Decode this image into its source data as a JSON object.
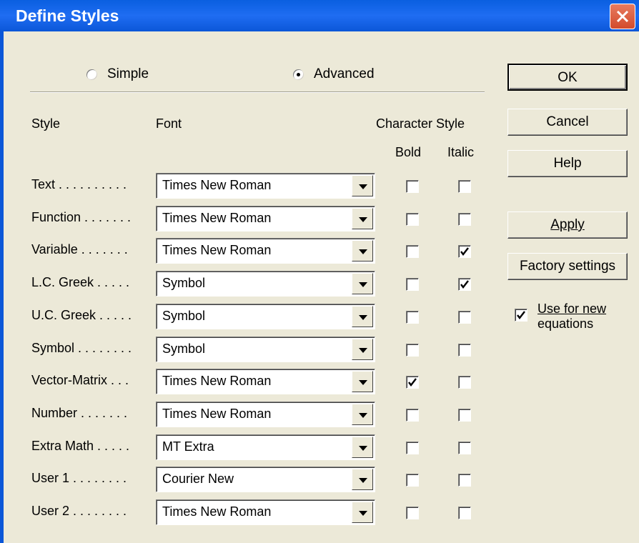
{
  "window": {
    "title": "Define Styles"
  },
  "mode": {
    "simple_label": "Simple",
    "advanced_label": "Advanced",
    "selected": "advanced"
  },
  "headers": {
    "style": "Style",
    "font": "Font",
    "character_style": "Character Style",
    "bold": "Bold",
    "italic": "Italic"
  },
  "rows": [
    {
      "label": "Text . . . . . . . . . .",
      "font": "Times New Roman",
      "bold": false,
      "italic": false
    },
    {
      "label": "Function . . . . . . .",
      "font": "Times New Roman",
      "bold": false,
      "italic": false
    },
    {
      "label": "Variable . . . . . . .",
      "font": "Times New Roman",
      "bold": false,
      "italic": true
    },
    {
      "label": "L.C. Greek . . . . .",
      "font": "Symbol",
      "bold": false,
      "italic": true
    },
    {
      "label": "U.C. Greek . . . . .",
      "font": "Symbol",
      "bold": false,
      "italic": false
    },
    {
      "label": "Symbol . . . . . . . .",
      "font": "Symbol",
      "bold": false,
      "italic": false
    },
    {
      "label": "Vector-Matrix . . .",
      "font": "Times New Roman",
      "bold": true,
      "italic": false
    },
    {
      "label": "Number . . . . . . .",
      "font": "Times New Roman",
      "bold": false,
      "italic": false
    },
    {
      "label": "Extra Math . . . . .",
      "font": "MT Extra",
      "bold": false,
      "italic": false
    },
    {
      "label": "User 1 . . . . . . . .",
      "font": "Courier New",
      "bold": false,
      "italic": false
    },
    {
      "label": "User 2 . . . . . . . .",
      "font": "Times New Roman",
      "bold": false,
      "italic": false
    }
  ],
  "buttons": {
    "ok": "OK",
    "cancel": "Cancel",
    "help": "Help",
    "apply": "Apply",
    "factory": "Factory settings"
  },
  "use_new": {
    "label_line1": "Use for new",
    "label_line2": "equations",
    "checked": true
  }
}
